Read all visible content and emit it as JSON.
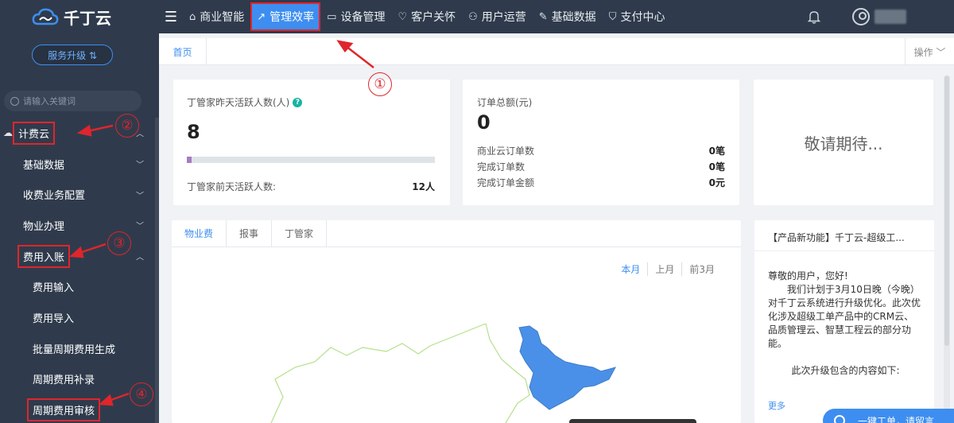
{
  "app": {
    "logo": "千丁云"
  },
  "nav": {
    "items": [
      {
        "label": "商业智能",
        "icon": "building-icon",
        "glyph": "⌂"
      },
      {
        "label": "管理效率",
        "icon": "chart-line-icon",
        "glyph": "↗"
      },
      {
        "label": "设备管理",
        "icon": "device-icon",
        "glyph": "▭"
      },
      {
        "label": "客户关怀",
        "icon": "heart-icon",
        "glyph": "♡"
      },
      {
        "label": "用户运营",
        "icon": "user-ops-icon",
        "glyph": "⚇"
      },
      {
        "label": "基础数据",
        "icon": "wrench-icon",
        "glyph": "✎"
      },
      {
        "label": "支付中心",
        "icon": "shield-icon",
        "glyph": "⛉"
      }
    ]
  },
  "sidebar": {
    "upgrade_label": "服务升级 ⇅",
    "search_placeholder": "请输入关键词",
    "items": [
      {
        "label": "计费云",
        "level": 0,
        "chevron": "︿"
      },
      {
        "label": "基础数据",
        "level": 1,
        "chevron": "﹀"
      },
      {
        "label": "收费业务配置",
        "level": 1,
        "chevron": "﹀"
      },
      {
        "label": "物业办理",
        "level": 1,
        "chevron": "﹀"
      },
      {
        "label": "费用入账",
        "level": 1,
        "chevron": "︿"
      },
      {
        "label": "费用输入",
        "level": 2,
        "chevron": ""
      },
      {
        "label": "费用导入",
        "level": 2,
        "chevron": ""
      },
      {
        "label": "批量周期费用生成",
        "level": 2,
        "chevron": ""
      },
      {
        "label": "周期费用补录",
        "level": 2,
        "chevron": ""
      },
      {
        "label": "周期费用审核",
        "level": 2,
        "chevron": ""
      }
    ]
  },
  "tabs": {
    "home": "首页",
    "operations": "操作 ﹀"
  },
  "card_active": {
    "title": "丁管家昨天活跃人数(人)",
    "value": "8",
    "progress": 0.02,
    "prev_label": "丁管家前天活跃人数:",
    "prev_value": "12人"
  },
  "card_orders": {
    "title": "订单总额(元)",
    "value": "0",
    "rows": [
      {
        "label": "商业云订单数",
        "value": "0笔"
      },
      {
        "label": "完成订单数",
        "value": "0笔"
      },
      {
        "label": "完成订单金额",
        "value": "0元"
      }
    ]
  },
  "card_coming": {
    "text": "敬请期待..."
  },
  "map_card": {
    "tabs": [
      "物业费",
      "报事",
      "丁管家"
    ],
    "periods": [
      "本月",
      "上月",
      "前3月"
    ]
  },
  "notice": {
    "title": "【产品新功能】千丁云-超级工...",
    "greeting": "尊敬的用户，您好!",
    "body": "我们计划于3月10日晚（今晚）对千丁云系统进行升级优化。此次优化涉及超级工单产品中的CRM云、品质管理云、智慧工程云的部分功能。",
    "footer": "此次升级包含的内容如下:",
    "more": "更多"
  },
  "float_button": {
    "label": "一键工单，请留言"
  },
  "annotations": [
    "①",
    "②",
    "③",
    "④"
  ],
  "colors": {
    "sidebar_bg": "#2f3b4c",
    "accent": "#3d8ef0",
    "annotation": "#e0252c"
  }
}
